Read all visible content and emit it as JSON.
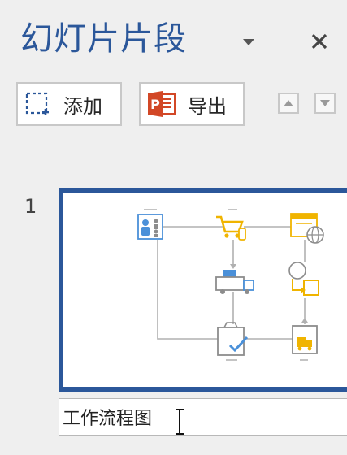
{
  "pane": {
    "title": "幻灯片片段",
    "dropdown_icon": "chevron-down-icon",
    "close_icon": "close-icon"
  },
  "toolbar": {
    "add_label": "添加",
    "add_icon": "dashed-add-icon",
    "export_label": "导出",
    "export_icon": "powerpoint-icon",
    "move_up_icon": "triangle-up-icon",
    "move_down_icon": "triangle-down-icon"
  },
  "slides": [
    {
      "number": "1",
      "name": "工作流程图",
      "thumbnail": "workflow-diagram-thumbnail"
    }
  ],
  "colors": {
    "accent": "#2b579a",
    "powerpoint": "#d24726",
    "diagram_blue": "#4a90d9",
    "diagram_yellow": "#f0b400",
    "diagram_gray": "#8c8c8c"
  }
}
